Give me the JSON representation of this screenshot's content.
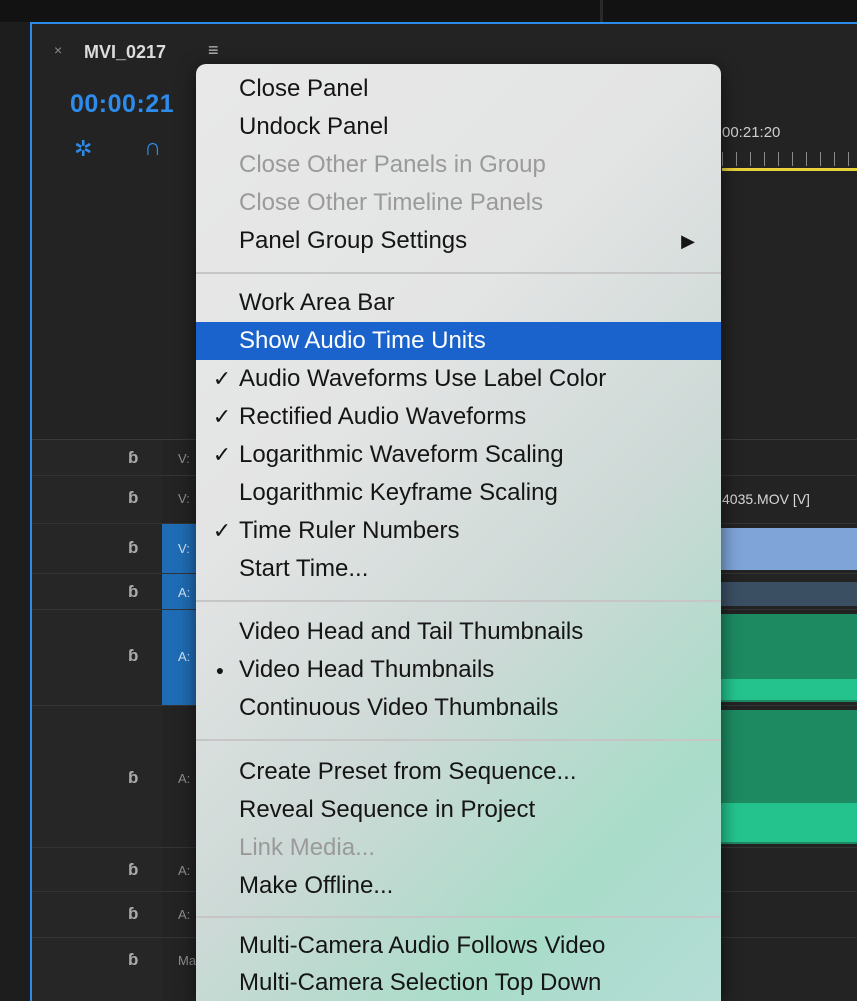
{
  "panel": {
    "close_glyph": "×",
    "tab_title": "MVI_0217",
    "menu_glyph": "≡",
    "timecode": "00:00:21",
    "ruler_time": "00:21:20",
    "snap_icon": "✲",
    "magnet_icon": "∩",
    "lock_icon": "🔓",
    "accent_color": "#2d8ceb",
    "playhead_color": "#e8d23c"
  },
  "tracks": [
    {
      "name": "V:",
      "lock": "ɓ"
    },
    {
      "name": "V:",
      "lock": "ɓ"
    },
    {
      "name": "V:",
      "lock": "ɓ"
    },
    {
      "name": "A:",
      "lock": "ɓ"
    },
    {
      "name": "A:",
      "lock": "ɓ"
    },
    {
      "name": "A:",
      "lock": "ɓ"
    },
    {
      "name": "A:",
      "lock": "ɓ"
    },
    {
      "name": "A:",
      "lock": "ɓ"
    },
    {
      "name": "Ma",
      "lock": "ɓ"
    }
  ],
  "clip": {
    "label": "4035.MOV [V]"
  },
  "menu": {
    "highlight_color": "#1a63cc",
    "check_glyph": "✓",
    "dot_glyph": "●",
    "submenu_arrow": "▶",
    "items": [
      {
        "label": "Close Panel",
        "state": "enabled",
        "mark": ""
      },
      {
        "label": "Undock Panel",
        "state": "enabled",
        "mark": ""
      },
      {
        "label": "Close Other Panels in Group",
        "state": "disabled",
        "mark": ""
      },
      {
        "label": "Close Other Timeline Panels",
        "state": "disabled",
        "mark": ""
      },
      {
        "label": "Panel Group Settings",
        "state": "enabled",
        "mark": "",
        "submenu": true
      },
      {
        "label": "Work Area Bar",
        "state": "enabled",
        "mark": ""
      },
      {
        "label": "Show Audio Time Units",
        "state": "highlighted",
        "mark": ""
      },
      {
        "label": "Audio Waveforms Use Label Color",
        "state": "enabled",
        "mark": "check"
      },
      {
        "label": "Rectified Audio Waveforms",
        "state": "enabled",
        "mark": "check"
      },
      {
        "label": "Logarithmic Waveform Scaling",
        "state": "enabled",
        "mark": "check"
      },
      {
        "label": "Logarithmic Keyframe Scaling",
        "state": "enabled",
        "mark": ""
      },
      {
        "label": "Time Ruler Numbers",
        "state": "enabled",
        "mark": "check"
      },
      {
        "label": "Start Time...",
        "state": "enabled",
        "mark": ""
      },
      {
        "label": "Video Head and Tail Thumbnails",
        "state": "enabled",
        "mark": ""
      },
      {
        "label": "Video Head Thumbnails",
        "state": "enabled",
        "mark": "dot"
      },
      {
        "label": "Continuous Video Thumbnails",
        "state": "enabled",
        "mark": ""
      },
      {
        "label": "Create Preset from Sequence...",
        "state": "enabled",
        "mark": ""
      },
      {
        "label": "Reveal Sequence in Project",
        "state": "enabled",
        "mark": ""
      },
      {
        "label": "Link Media...",
        "state": "disabled",
        "mark": ""
      },
      {
        "label": "Make Offline...",
        "state": "enabled",
        "mark": ""
      },
      {
        "label": "Multi-Camera Audio Follows Video",
        "state": "enabled",
        "mark": ""
      },
      {
        "label": "Multi-Camera Selection Top Down",
        "state": "enabled",
        "mark": ""
      }
    ]
  }
}
